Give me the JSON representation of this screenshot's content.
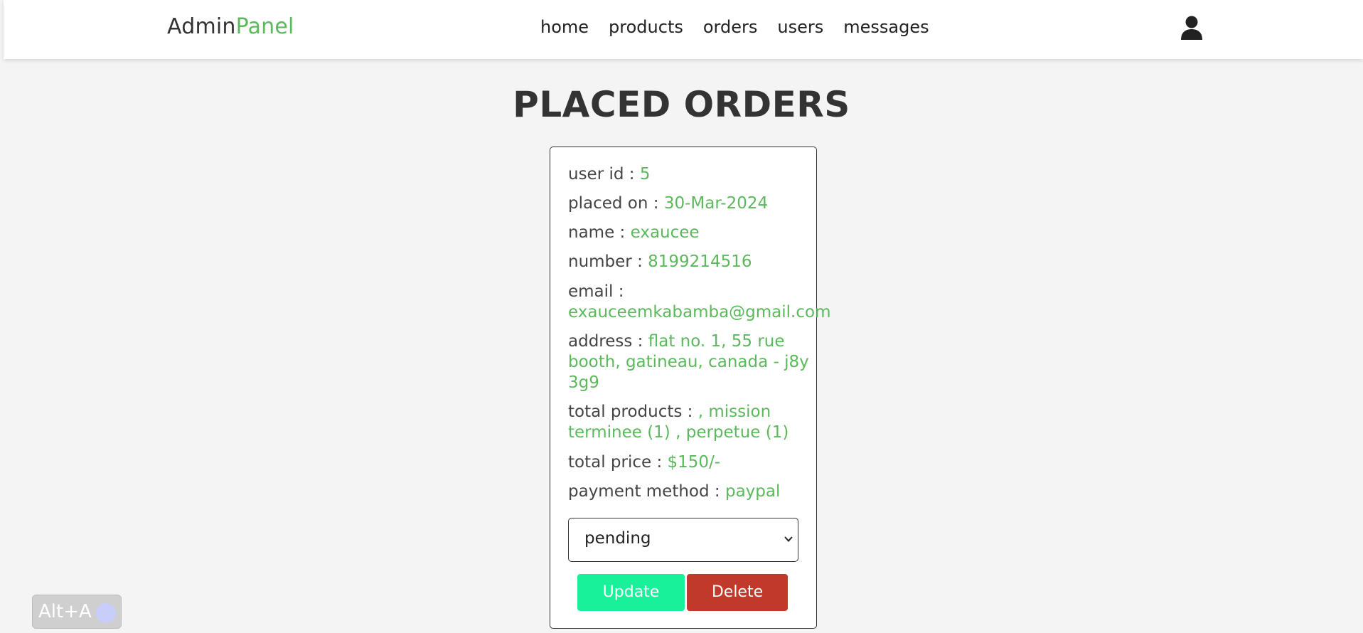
{
  "header": {
    "logo_main": "Admin",
    "logo_accent": "Panel",
    "nav": [
      "home",
      "products",
      "orders",
      "users",
      "messages"
    ],
    "user_icon": "user-icon"
  },
  "page": {
    "title": "PLACED ORDERS"
  },
  "order": {
    "user_id_label": "user id : ",
    "user_id": "5",
    "placed_on_label": "placed on : ",
    "placed_on": "30-Mar-2024",
    "name_label": "name : ",
    "name": "exaucee",
    "number_label": "number : ",
    "number": "8199214516",
    "email_label": "email : ",
    "email": "exauceemkabamba@gmail.com",
    "address_label": "address : ",
    "address": "flat no. 1, 55 rue booth, gatineau, canada - j8y 3g9",
    "total_products_label": "total products : ",
    "total_products": ", mission terminee (1) , perpetue (1)",
    "total_price_label": "total price : ",
    "total_price": "$150/-",
    "payment_method_label": "payment method : ",
    "payment_method": "paypal",
    "status_selected": "pending",
    "update_label": "Update",
    "delete_label": "Delete"
  },
  "shortcut_badge": {
    "label": "Alt+A"
  },
  "colors": {
    "accent": "#5cb85c",
    "update": "#19f09a",
    "delete": "#c0392b"
  }
}
